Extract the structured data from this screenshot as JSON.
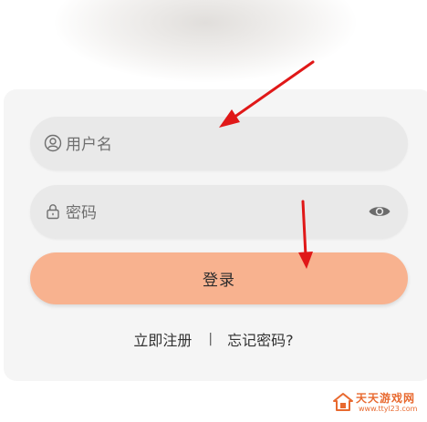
{
  "login_form": {
    "username_placeholder": "用户名",
    "password_placeholder": "密码",
    "login_label": "登录"
  },
  "links": {
    "register": "立即注册",
    "separator": "|",
    "forgot": "忘记密码?"
  },
  "icons": {
    "username": "user-icon",
    "password": "lock-icon",
    "toggle_visibility": "eye-icon"
  },
  "watermark": {
    "title": "天天游戏网",
    "url": "www.ttyl23.com"
  },
  "colors": {
    "card_background": "#f5f5f5",
    "field_background": "#e9e9e9",
    "login_button": "#f8b28f",
    "annotation_arrow": "#e01818",
    "watermark": "#e8692f"
  }
}
